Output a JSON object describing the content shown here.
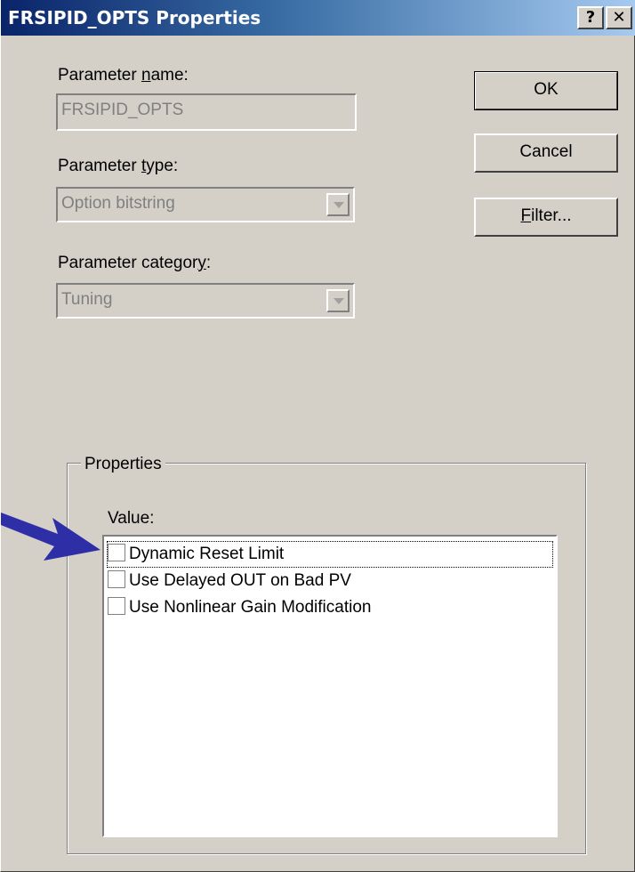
{
  "window": {
    "title": "FRSIPID_OPTS Properties",
    "help_label": "?",
    "close_label": "✕"
  },
  "form": {
    "name_label_pre": "Parameter ",
    "name_label_key": "n",
    "name_label_post": "ame:",
    "name_value": "FRSIPID_OPTS",
    "type_label_pre": "Parameter ",
    "type_label_key": "t",
    "type_label_post": "ype:",
    "type_value": "Option bitstring",
    "category_label_pre": "Parameter categor",
    "category_label_key": "y",
    "category_label_post": ":",
    "category_value": "Tuning"
  },
  "buttons": {
    "ok": "OK",
    "cancel": "Cancel",
    "filter_key": "F",
    "filter_rest": "ilter..."
  },
  "properties": {
    "group_title": "Properties",
    "value_label": "Value:",
    "items": [
      {
        "label": "Dynamic Reset Limit",
        "checked": false
      },
      {
        "label": "Use Delayed OUT on Bad PV",
        "checked": false
      },
      {
        "label": "Use Nonlinear Gain Modification",
        "checked": false
      }
    ]
  },
  "colors": {
    "arrow": "#2e2fa6",
    "titlebar_start": "#0a246a",
    "titlebar_end": "#a6caf0",
    "face": "#d4d0c8"
  }
}
